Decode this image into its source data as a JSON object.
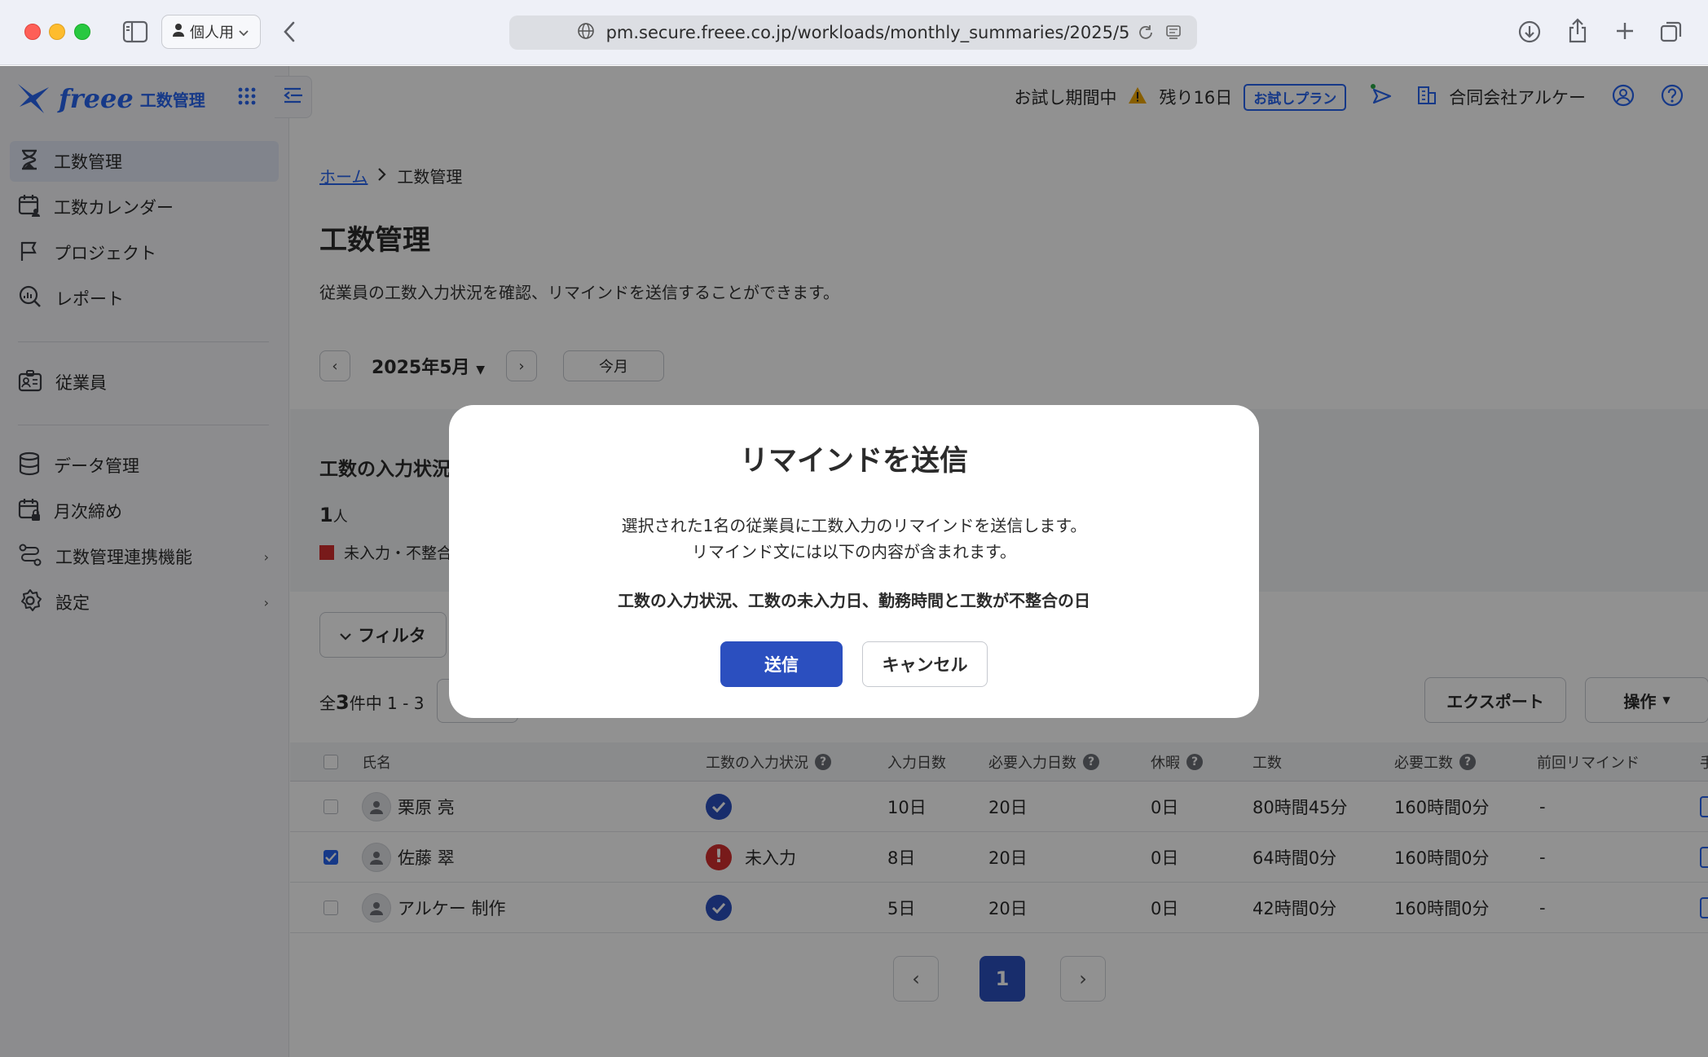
{
  "browser": {
    "profile_label": "個人用",
    "url": "pm.secure.freee.co.jp/workloads/monthly_summaries/2025/5"
  },
  "header": {
    "trial_text": "お試し期間中",
    "days_left": "残り16日",
    "trial_badge": "お試しプラン",
    "company": "合同会社アルケー"
  },
  "sidebar": {
    "logo_brand": "freee",
    "logo_sub": "工数管理",
    "items": [
      {
        "label": "工数管理",
        "icon": "hourglass-icon",
        "active": true
      },
      {
        "label": "工数カレンダー",
        "icon": "calendar-user-icon"
      },
      {
        "label": "プロジェクト",
        "icon": "flag-icon"
      },
      {
        "label": "レポート",
        "icon": "report-search-icon"
      },
      {
        "label": "従業員",
        "icon": "employee-badge-icon"
      },
      {
        "label": "データ管理",
        "icon": "database-icon"
      },
      {
        "label": "月次締め",
        "icon": "calendar-lock-icon"
      },
      {
        "label": "工数管理連携機能",
        "icon": "integration-icon"
      },
      {
        "label": "設定",
        "icon": "gear-icon"
      }
    ]
  },
  "main": {
    "breadcrumb_home": "ホーム",
    "breadcrumb_current": "工数管理",
    "title": "工数管理",
    "description": "従業員の工数入力状況を確認、リマインドを送信することができます。",
    "month": "2025年5月",
    "today_label": "今月",
    "status_title": "工数の入力状況",
    "status_count": "1",
    "status_unit": "人",
    "status_legend": "未入力・不整合",
    "filter_label": "フィルタ",
    "count_prefix": "全",
    "count_total": "3",
    "count_suffix": "件中 1 - 3",
    "export_label": "エクスポート",
    "ops_label": "操作"
  },
  "table": {
    "headers": {
      "name": "氏名",
      "input_status": "工数の入力状況",
      "input_days": "入力日数",
      "required_days": "必要入力日数",
      "leave": "休暇",
      "workload": "工数",
      "required_workload": "必要工数",
      "last_remind": "前回リマインド",
      "extra": "手"
    },
    "rows": [
      {
        "name": "栗原 亮",
        "status": "ok",
        "status_text": "",
        "input_days": "10日",
        "required_days": "20日",
        "leave": "0日",
        "workload": "80時間45分",
        "required_workload": "160時間0分",
        "last_remind": "-",
        "checked": false
      },
      {
        "name": "佐藤 翠",
        "status": "warn",
        "status_text": "未入力",
        "input_days": "8日",
        "required_days": "20日",
        "leave": "0日",
        "workload": "64時間0分",
        "required_workload": "160時間0分",
        "last_remind": "-",
        "checked": true
      },
      {
        "name": "アルケー 制作",
        "status": "ok",
        "status_text": "",
        "input_days": "5日",
        "required_days": "20日",
        "leave": "0日",
        "workload": "42時間0分",
        "required_workload": "160時間0分",
        "last_remind": "-",
        "checked": false
      }
    ]
  },
  "pagination": {
    "current": "1"
  },
  "modal": {
    "title": "リマインドを送信",
    "line1": "選択された1名の従業員に工数入力のリマインドを送信します。",
    "line2": "リマインド文には以下の内容が含まれます。",
    "strong": "工数の入力状況、工数の未入力日、勤務時間と工数が不整合の日",
    "send_label": "送信",
    "cancel_label": "キャンセル"
  },
  "colors": {
    "accent": "#2864f0",
    "primary_button": "#2b4fbf",
    "warning": "#d32f2f"
  }
}
